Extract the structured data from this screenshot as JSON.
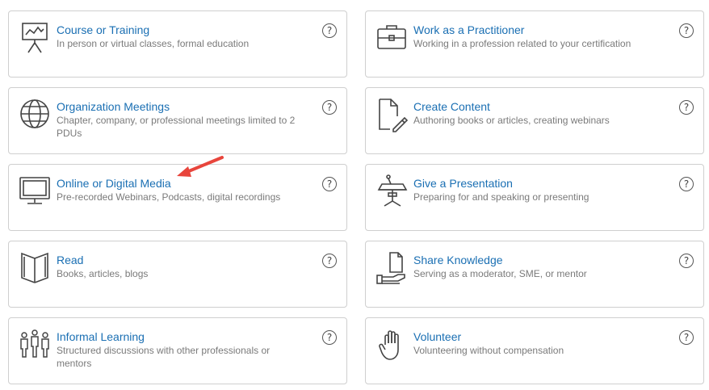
{
  "help_glyph": "?",
  "cards": {
    "course": {
      "title": "Course or Training",
      "description": "In person or virtual classes, formal education",
      "icon": "presentation-board-icon"
    },
    "practitioner": {
      "title": "Work as a Practitioner",
      "description": "Working in a profession related to your certification",
      "icon": "briefcase-icon"
    },
    "meetings": {
      "title": "Organization Meetings",
      "description": "Chapter, company, or professional meetings limited to 2 PDUs",
      "icon": "globe-icon"
    },
    "content": {
      "title": "Create Content",
      "description": "Authoring books or articles, creating webinars",
      "icon": "document-pencil-icon"
    },
    "media": {
      "title": "Online or Digital Media",
      "description": "Pre-recorded Webinars, Podcasts, digital recordings",
      "icon": "monitor-icon"
    },
    "presentation": {
      "title": "Give a Presentation",
      "description": "Preparing for and speaking or presenting",
      "icon": "podium-icon"
    },
    "read": {
      "title": "Read",
      "description": "Books, articles, blogs",
      "icon": "open-book-icon"
    },
    "share": {
      "title": "Share Knowledge",
      "description": "Serving as a moderator, SME, or mentor",
      "icon": "hand-document-icon"
    },
    "informal": {
      "title": "Informal Learning",
      "description": "Structured discussions with other professionals or mentors",
      "icon": "people-group-icon"
    },
    "volunteer": {
      "title": "Volunteer",
      "description": "Volunteering without compensation",
      "icon": "raised-hand-icon"
    }
  },
  "colors": {
    "title": "#1a6fb3",
    "description": "#7a7a7a",
    "border": "#cfcfcf",
    "annotation_arrow": "#e8453c"
  }
}
